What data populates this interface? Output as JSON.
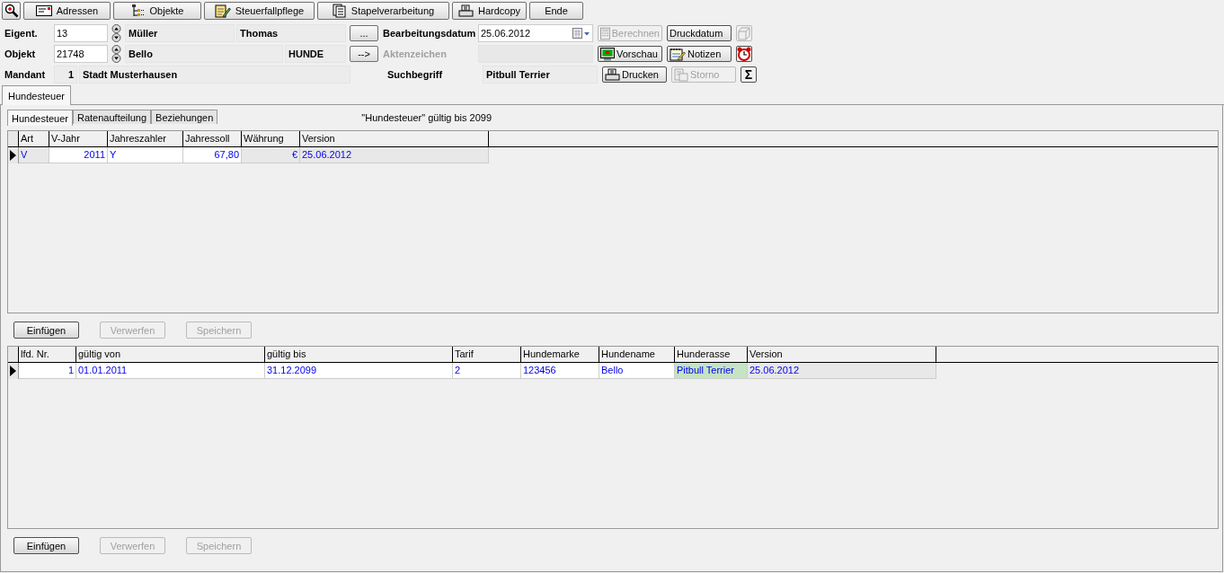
{
  "toolbar": {
    "buttons": [
      {
        "label": "Adressen"
      },
      {
        "label": "Objekte"
      },
      {
        "label": "Steuerfallpflege"
      },
      {
        "label": "Stapelverarbeitung"
      },
      {
        "label": "Hardcopy"
      },
      {
        "label": "Ende"
      }
    ]
  },
  "form": {
    "rows": [
      {
        "label": "Eigent.",
        "number": "13",
        "spinner": true,
        "fields": [
          {
            "value": "Müller"
          },
          {
            "value": "Thomas"
          }
        ],
        "button": "...",
        "right_label": "Bearbeitungsdatum",
        "right_disabled": false,
        "right_field": {
          "kind": "date",
          "value": "25.06.2012"
        }
      },
      {
        "label": "Objekt",
        "number": "21748",
        "spinner": true,
        "fields": [
          {
            "value": "Bello"
          },
          {
            "value": "HUNDE"
          }
        ],
        "button": "-->",
        "right_label": "Aktenzeichen",
        "right_disabled": true,
        "right_field": {
          "kind": "text"
        }
      },
      {
        "label": "Mandant",
        "number": "1",
        "spinner": false,
        "fields": [
          {
            "value": "Stadt Musterhausen"
          }
        ],
        "right_label": "Suchbegriff",
        "right_disabled": false,
        "right_field": {
          "kind": "text",
          "value": "Pitbull Terrier"
        }
      }
    ],
    "actions": [
      {
        "label": "Berechnen",
        "disabled": true
      },
      {
        "label": "Druckdatum",
        "disabled": false
      },
      {
        "label": "Vorschau",
        "disabled": false
      },
      {
        "label": "Notizen",
        "disabled": false
      },
      {
        "label": "Drucken",
        "disabled": false
      },
      {
        "label": "Storno",
        "disabled": true
      }
    ],
    "side_buttons": [
      {
        "kind": "copy",
        "disabled": true
      },
      {
        "kind": "alarm",
        "disabled": false
      },
      {
        "kind": "sum",
        "label": "Σ",
        "disabled": false
      }
    ]
  },
  "outer_tabs": [
    {
      "label": "Hundesteuer",
      "selected": true
    }
  ],
  "inner_tabs": [
    {
      "label": "Hundesteuer",
      "selected": true
    },
    {
      "label": "Ratenaufteilung",
      "selected": false
    },
    {
      "label": "Beziehungen",
      "selected": false
    }
  ],
  "validity_note": "\"Hundesteuer\" gültig bis 2099",
  "grids": [
    {
      "columns": [
        {
          "label": "Art"
        },
        {
          "label": "V-Jahr"
        },
        {
          "label": "Jahreszahler"
        },
        {
          "label": "Jahressoll"
        },
        {
          "label": "Währung"
        },
        {
          "label": "Version"
        }
      ],
      "rows": [
        {
          "current": true,
          "cells": [
            {
              "text": "V",
              "kind": "readonly"
            },
            {
              "text": "2011",
              "kind": "edit"
            },
            {
              "text": "Y",
              "kind": "edit"
            },
            {
              "text": "67,80",
              "kind": "edit"
            },
            {
              "text": "€",
              "kind": "readonly"
            },
            {
              "text": "25.06.2012",
              "kind": "readonly"
            }
          ]
        }
      ],
      "buttons": [
        {
          "label": "Einfügen",
          "disabled": false
        },
        {
          "label": "Verwerfen",
          "disabled": true
        },
        {
          "label": "Speichern",
          "disabled": true
        }
      ]
    },
    {
      "columns": [
        {
          "label": "lfd. Nr."
        },
        {
          "label": "gültig von"
        },
        {
          "label": "gültig bis"
        },
        {
          "label": "Tarif"
        },
        {
          "label": "Hundemarke"
        },
        {
          "label": "Hundename"
        },
        {
          "label": "Hunderasse"
        },
        {
          "label": "Version"
        }
      ],
      "rows": [
        {
          "current": true,
          "cells": [
            {
              "text": "1",
              "kind": "edit"
            },
            {
              "text": "01.01.2011",
              "kind": "edit"
            },
            {
              "text": "31.12.2099",
              "kind": "edit"
            },
            {
              "text": "2",
              "kind": "edit"
            },
            {
              "text": "123456",
              "kind": "edit"
            },
            {
              "text": "Bello",
              "kind": "edit"
            },
            {
              "text": "Pitbull Terrier",
              "kind": "marked"
            },
            {
              "text": "25.06.2012",
              "kind": "readonly"
            }
          ]
        }
      ],
      "buttons": [
        {
          "label": "Einfügen",
          "disabled": false
        },
        {
          "label": "Verwerfen",
          "disabled": true
        },
        {
          "label": "Speichern",
          "disabled": true
        }
      ]
    }
  ]
}
